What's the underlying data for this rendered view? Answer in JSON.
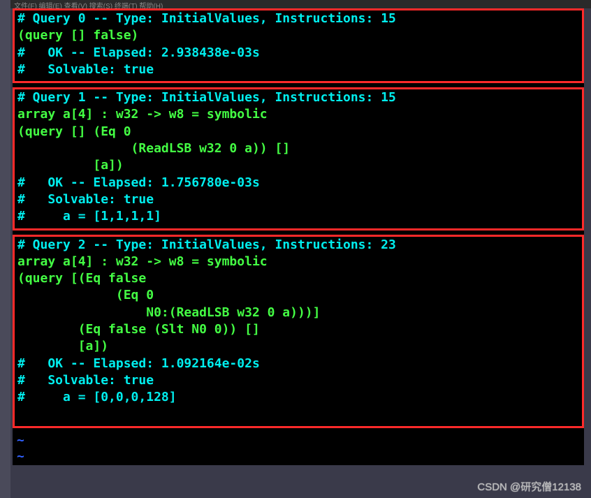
{
  "menubar": "文件(F)  编辑(E)  查看(V)  搜索(S)  终端(T)  帮助(H)",
  "queries": [
    {
      "header": "# Query 0 -- Type: InitialValues, Instructions: 15",
      "body": [
        "(query [] false)"
      ],
      "ok": "#   OK -- Elapsed: 2.938438e-03s",
      "solvable": "#   Solvable: true",
      "result": null
    },
    {
      "header": "# Query 1 -- Type: InitialValues, Instructions: 15",
      "body": [
        "array a[4] : w32 -> w8 = symbolic",
        "(query [] (Eq 0",
        "               (ReadLSB w32 0 a)) []",
        "          [a])"
      ],
      "ok": "#   OK -- Elapsed: 1.756780e-03s",
      "solvable": "#   Solvable: true",
      "result": "#     a = [1,1,1,1]"
    },
    {
      "header": "# Query 2 -- Type: InitialValues, Instructions: 23",
      "body": [
        "array a[4] : w32 -> w8 = symbolic",
        "(query [(Eq false",
        "             (Eq 0",
        "                 N0:(ReadLSB w32 0 a)))]",
        "        (Eq false (Slt N0 0)) []",
        "        [a])"
      ],
      "ok": "#   OK -- Elapsed: 1.092164e-02s",
      "solvable": "#   Solvable: true",
      "result": "#     a = [0,0,0,128]"
    }
  ],
  "tildes": [
    "~",
    "~"
  ],
  "watermark": "CSDN @研究僧12138"
}
